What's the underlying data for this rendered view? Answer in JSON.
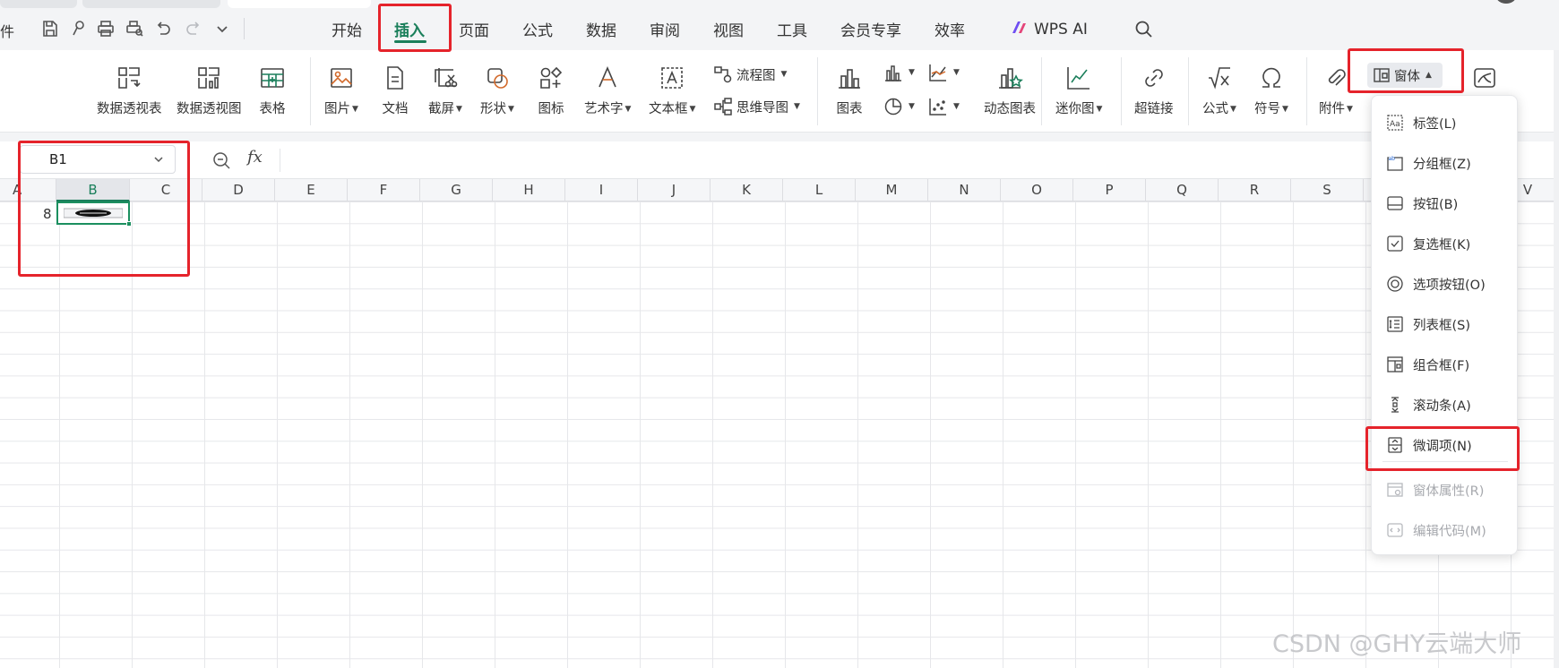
{
  "menubar": {
    "file_partial": "件",
    "tabs": [
      "开始",
      "插入",
      "页面",
      "公式",
      "数据",
      "审阅",
      "视图",
      "工具",
      "会员专享",
      "效率"
    ],
    "active_tab": "插入",
    "wps_ai": "WPS AI"
  },
  "ribbon": {
    "pivot_table": "数据透视表",
    "pivot_chart": "数据透视图",
    "table": "表格",
    "picture": "图片",
    "document": "文档",
    "screenshot": "截屏",
    "shape": "形状",
    "icon": "图标",
    "wordart": "艺术字",
    "textbox": "文本框",
    "flowchart": "流程图",
    "mindmap": "思维导图",
    "chart": "图表",
    "dynamic_chart": "动态图表",
    "sparkline": "迷你图",
    "hyperlink": "超链接",
    "formula": "公式",
    "symbol": "符号",
    "attachment": "附件",
    "form": "窗体"
  },
  "formula_bar": {
    "name_box": "B1",
    "fx": "fx"
  },
  "grid": {
    "columns": [
      "A",
      "B",
      "C",
      "D",
      "E",
      "F",
      "G",
      "H",
      "I",
      "J",
      "K",
      "L",
      "M",
      "N",
      "O",
      "P",
      "Q",
      "R",
      "S",
      "V"
    ],
    "selected_column": "B",
    "row_value": "8"
  },
  "dropdown": {
    "items": [
      {
        "label": "标签(L)",
        "icon": "label-icon",
        "disabled": false
      },
      {
        "label": "分组框(Z)",
        "icon": "group-box-icon",
        "disabled": false
      },
      {
        "label": "按钮(B)",
        "icon": "button-icon",
        "disabled": false
      },
      {
        "label": "复选框(K)",
        "icon": "checkbox-icon",
        "disabled": false
      },
      {
        "label": "选项按钮(O)",
        "icon": "radio-icon",
        "disabled": false
      },
      {
        "label": "列表框(S)",
        "icon": "listbox-icon",
        "disabled": false
      },
      {
        "label": "组合框(F)",
        "icon": "combobox-icon",
        "disabled": false
      },
      {
        "label": "滚动条(A)",
        "icon": "scrollbar-icon",
        "disabled": false
      },
      {
        "label": "微调项(N)",
        "icon": "spinner-icon",
        "disabled": false
      },
      {
        "label": "窗体属性(R)",
        "icon": "form-properties-icon",
        "disabled": true
      },
      {
        "label": "编辑代码(M)",
        "icon": "edit-code-icon",
        "disabled": true
      }
    ]
  },
  "watermark": "CSDN @GHY云端大师",
  "colors": {
    "accent_green": "#1b7f5b",
    "annotation_red": "#e5232b"
  }
}
